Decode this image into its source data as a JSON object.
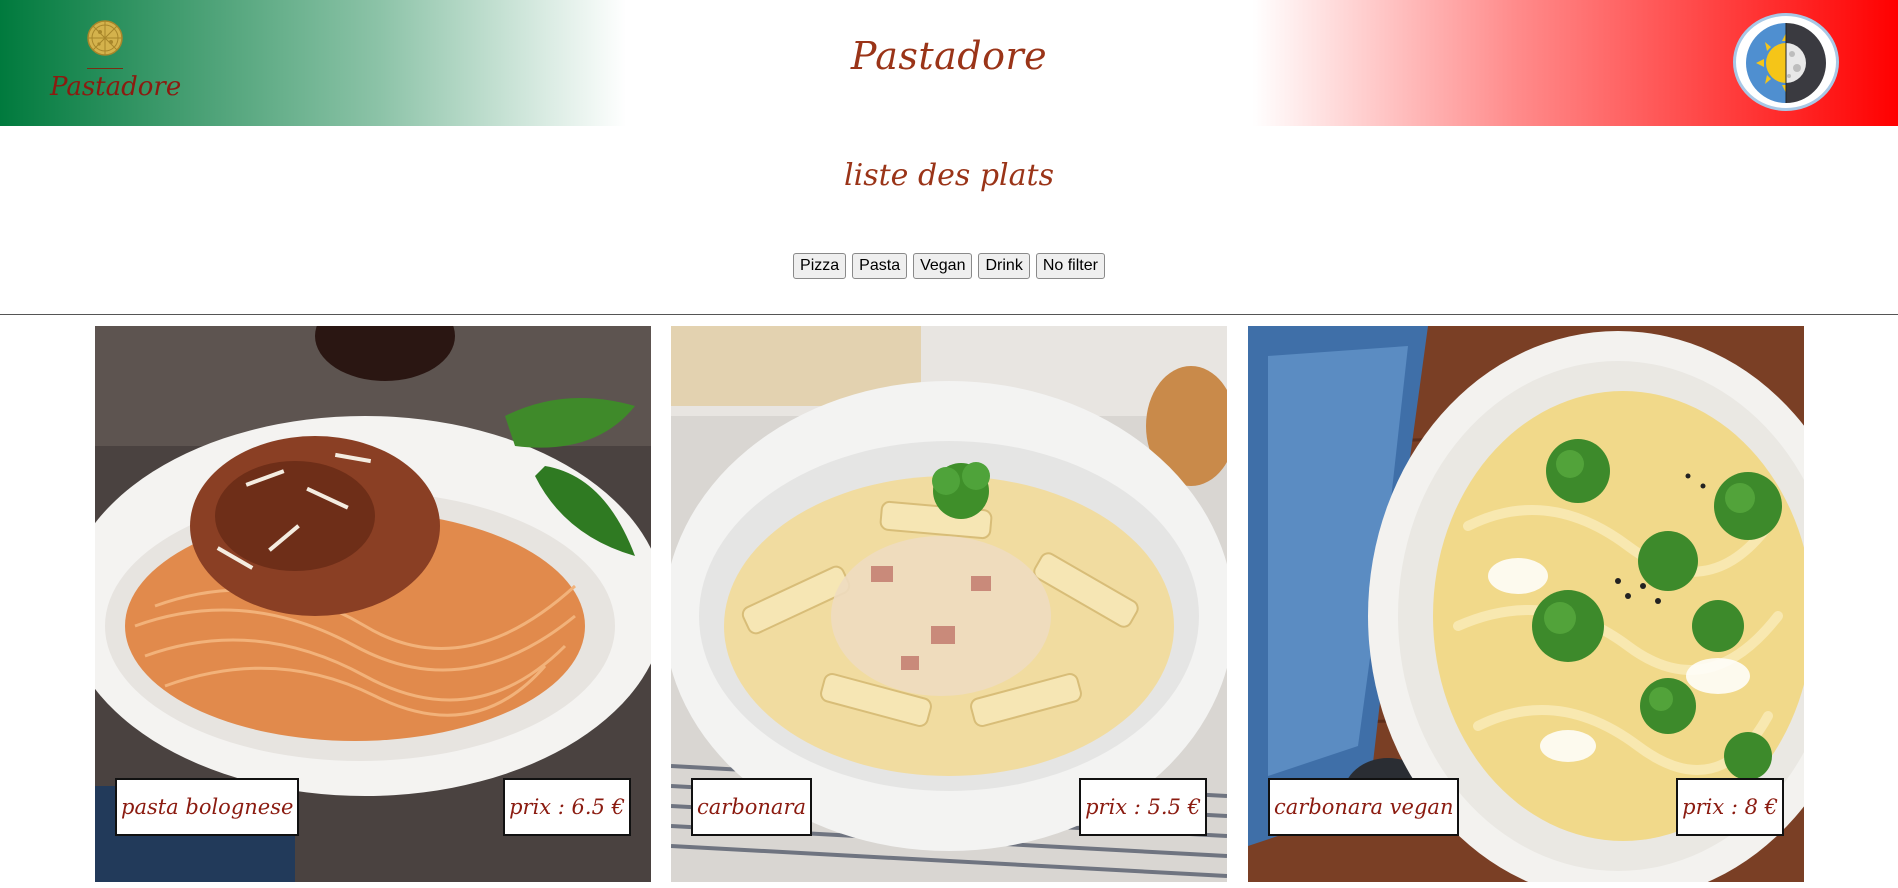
{
  "header": {
    "logo_text": "Pastadore",
    "title": "Pastadore",
    "theme_toggle_icon": "sun-moon-icon"
  },
  "main": {
    "heading": "liste des plats",
    "filters": [
      "Pizza",
      "Pasta",
      "Vegan",
      "Drink",
      "No filter"
    ],
    "dishes": [
      {
        "name": "pasta bolognese",
        "price": "prix : 6.5 €"
      },
      {
        "name": "carbonara",
        "price": "prix : 5.5 €"
      },
      {
        "name": "carbonara vegan",
        "price": "prix : 8 €"
      }
    ]
  },
  "colors": {
    "italy_green": "#007a3d",
    "italy_red": "#ff0000",
    "title_brown": "#9a3418",
    "label_red": "#8b1b10"
  }
}
